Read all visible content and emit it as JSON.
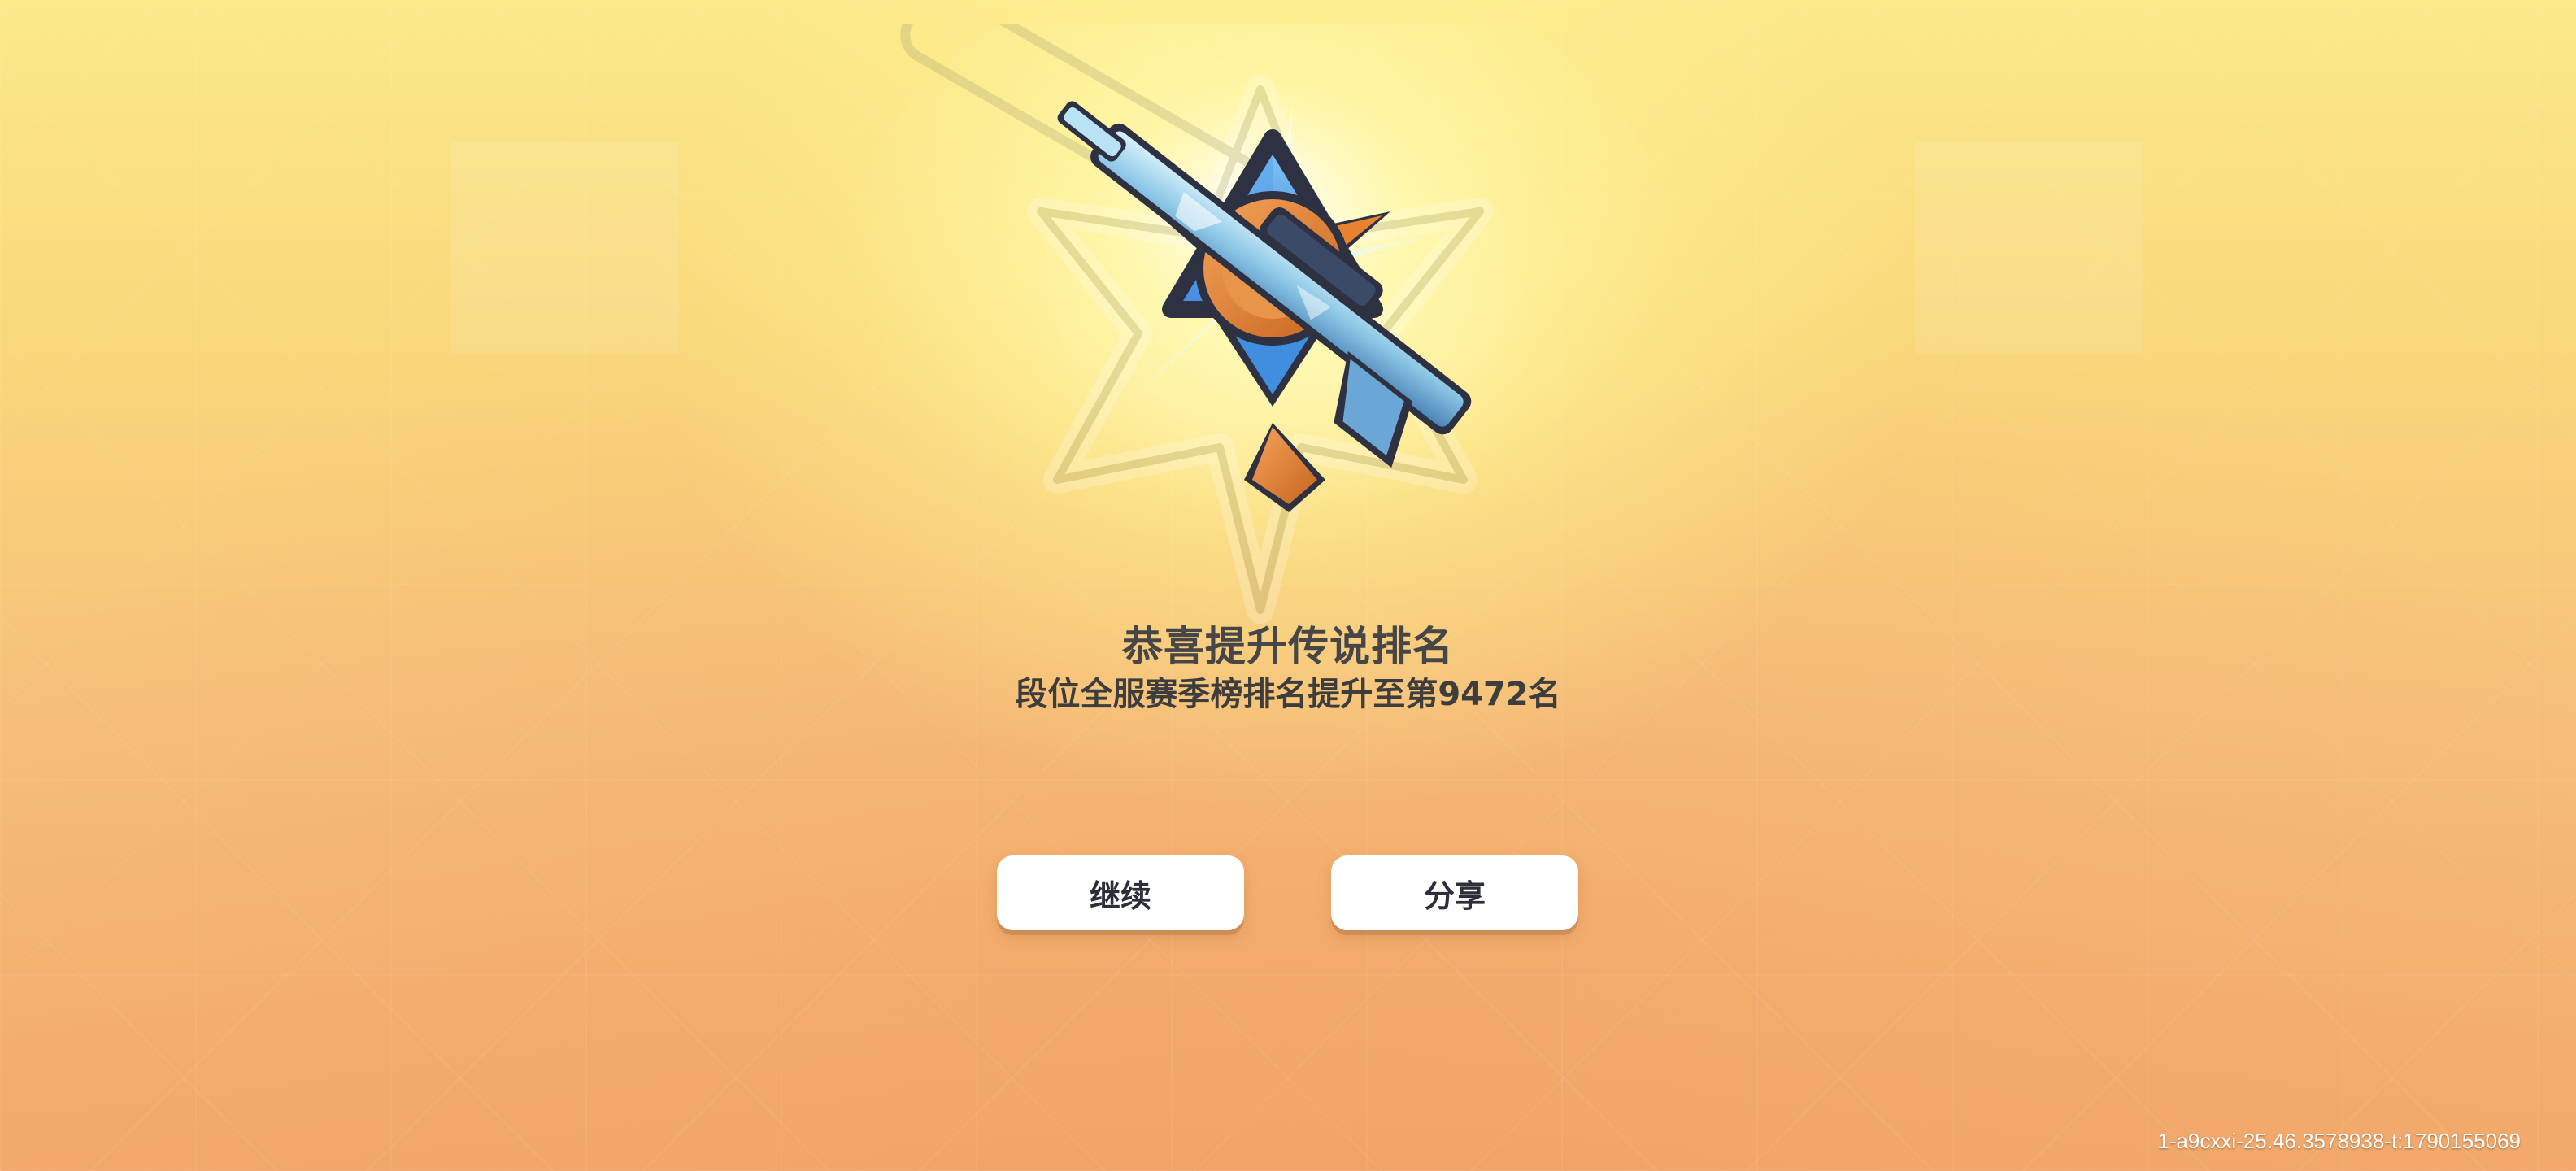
{
  "result": {
    "title": "恭喜提升传说排名",
    "subtitle": "段位全服赛季榜排名提升至第9472名"
  },
  "buttons": {
    "continue_label": "继续",
    "share_label": "分享"
  },
  "footer": {
    "build_id": "1-a9cxxi-25.46.3578938-t:1790155069"
  },
  "emblem": {
    "icon": "legend-rank-star-sniper-emblem",
    "colors": {
      "star_blue": "#3f8ee0",
      "star_orange": "#e8822f",
      "rifle_ice": "#9fd3ef",
      "outline": "#2e3142"
    }
  },
  "theme": {
    "background_top": "#fbe98a",
    "background_bottom": "#f2a96b",
    "button_bg": "#ffffff",
    "text_color": "#464646"
  }
}
